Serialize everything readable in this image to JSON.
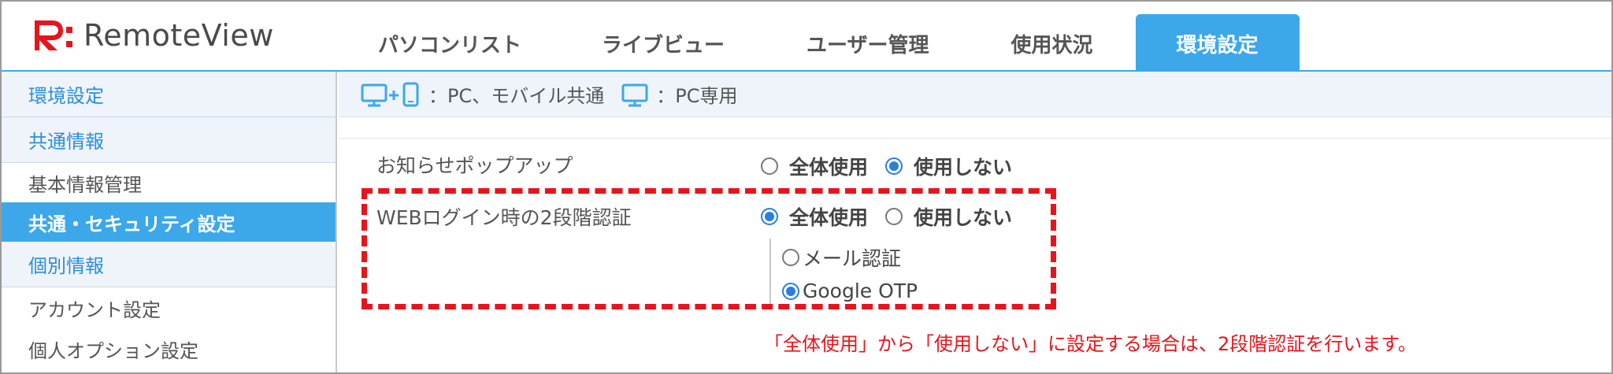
{
  "app": {
    "logo_text": "RemoteView",
    "brand_color": "#e8141c",
    "accent_color": "#3ca8ea"
  },
  "nav": {
    "tabs": [
      {
        "label": "パソコンリスト",
        "active": false
      },
      {
        "label": "ライブビュー",
        "active": false
      },
      {
        "label": "ユーザー管理",
        "active": false
      },
      {
        "label": "使用状況",
        "active": false
      },
      {
        "label": "環境設定",
        "active": true
      }
    ]
  },
  "sidebar": {
    "items": [
      {
        "label": "環境設定",
        "kind": "section"
      },
      {
        "label": "共通情報",
        "kind": "section"
      },
      {
        "label": "基本情報管理",
        "kind": "plain"
      },
      {
        "label": "共通・セキュリティ設定",
        "kind": "selected"
      },
      {
        "label": "個別情報",
        "kind": "section"
      },
      {
        "label": "アカウント設定",
        "kind": "plain"
      },
      {
        "label": "個人オプション設定",
        "kind": "plain"
      }
    ]
  },
  "legend": {
    "common_icon": "pc-plus-mobile-icon",
    "common_text": "：PC、モバイル共通",
    "pc_icon": "pc-icon",
    "pc_text": "：PC専用"
  },
  "settings": {
    "popup": {
      "label": "お知らせポップアップ",
      "options": [
        {
          "label": "全体使用",
          "checked": false
        },
        {
          "label": "使用しない",
          "checked": true
        }
      ]
    },
    "two_factor": {
      "label": "WEBログイン時の2段階認証",
      "options": [
        {
          "label": "全体使用",
          "checked": true
        },
        {
          "label": "使用しない",
          "checked": false
        }
      ],
      "methods": [
        {
          "label": "メール認証",
          "checked": false
        },
        {
          "label": "Google OTP",
          "checked": true
        }
      ]
    }
  },
  "warning": {
    "text": "「全体使用」から「使用しない」に設定する場合は、2段階認証を行います。",
    "color": "#e8141c"
  }
}
